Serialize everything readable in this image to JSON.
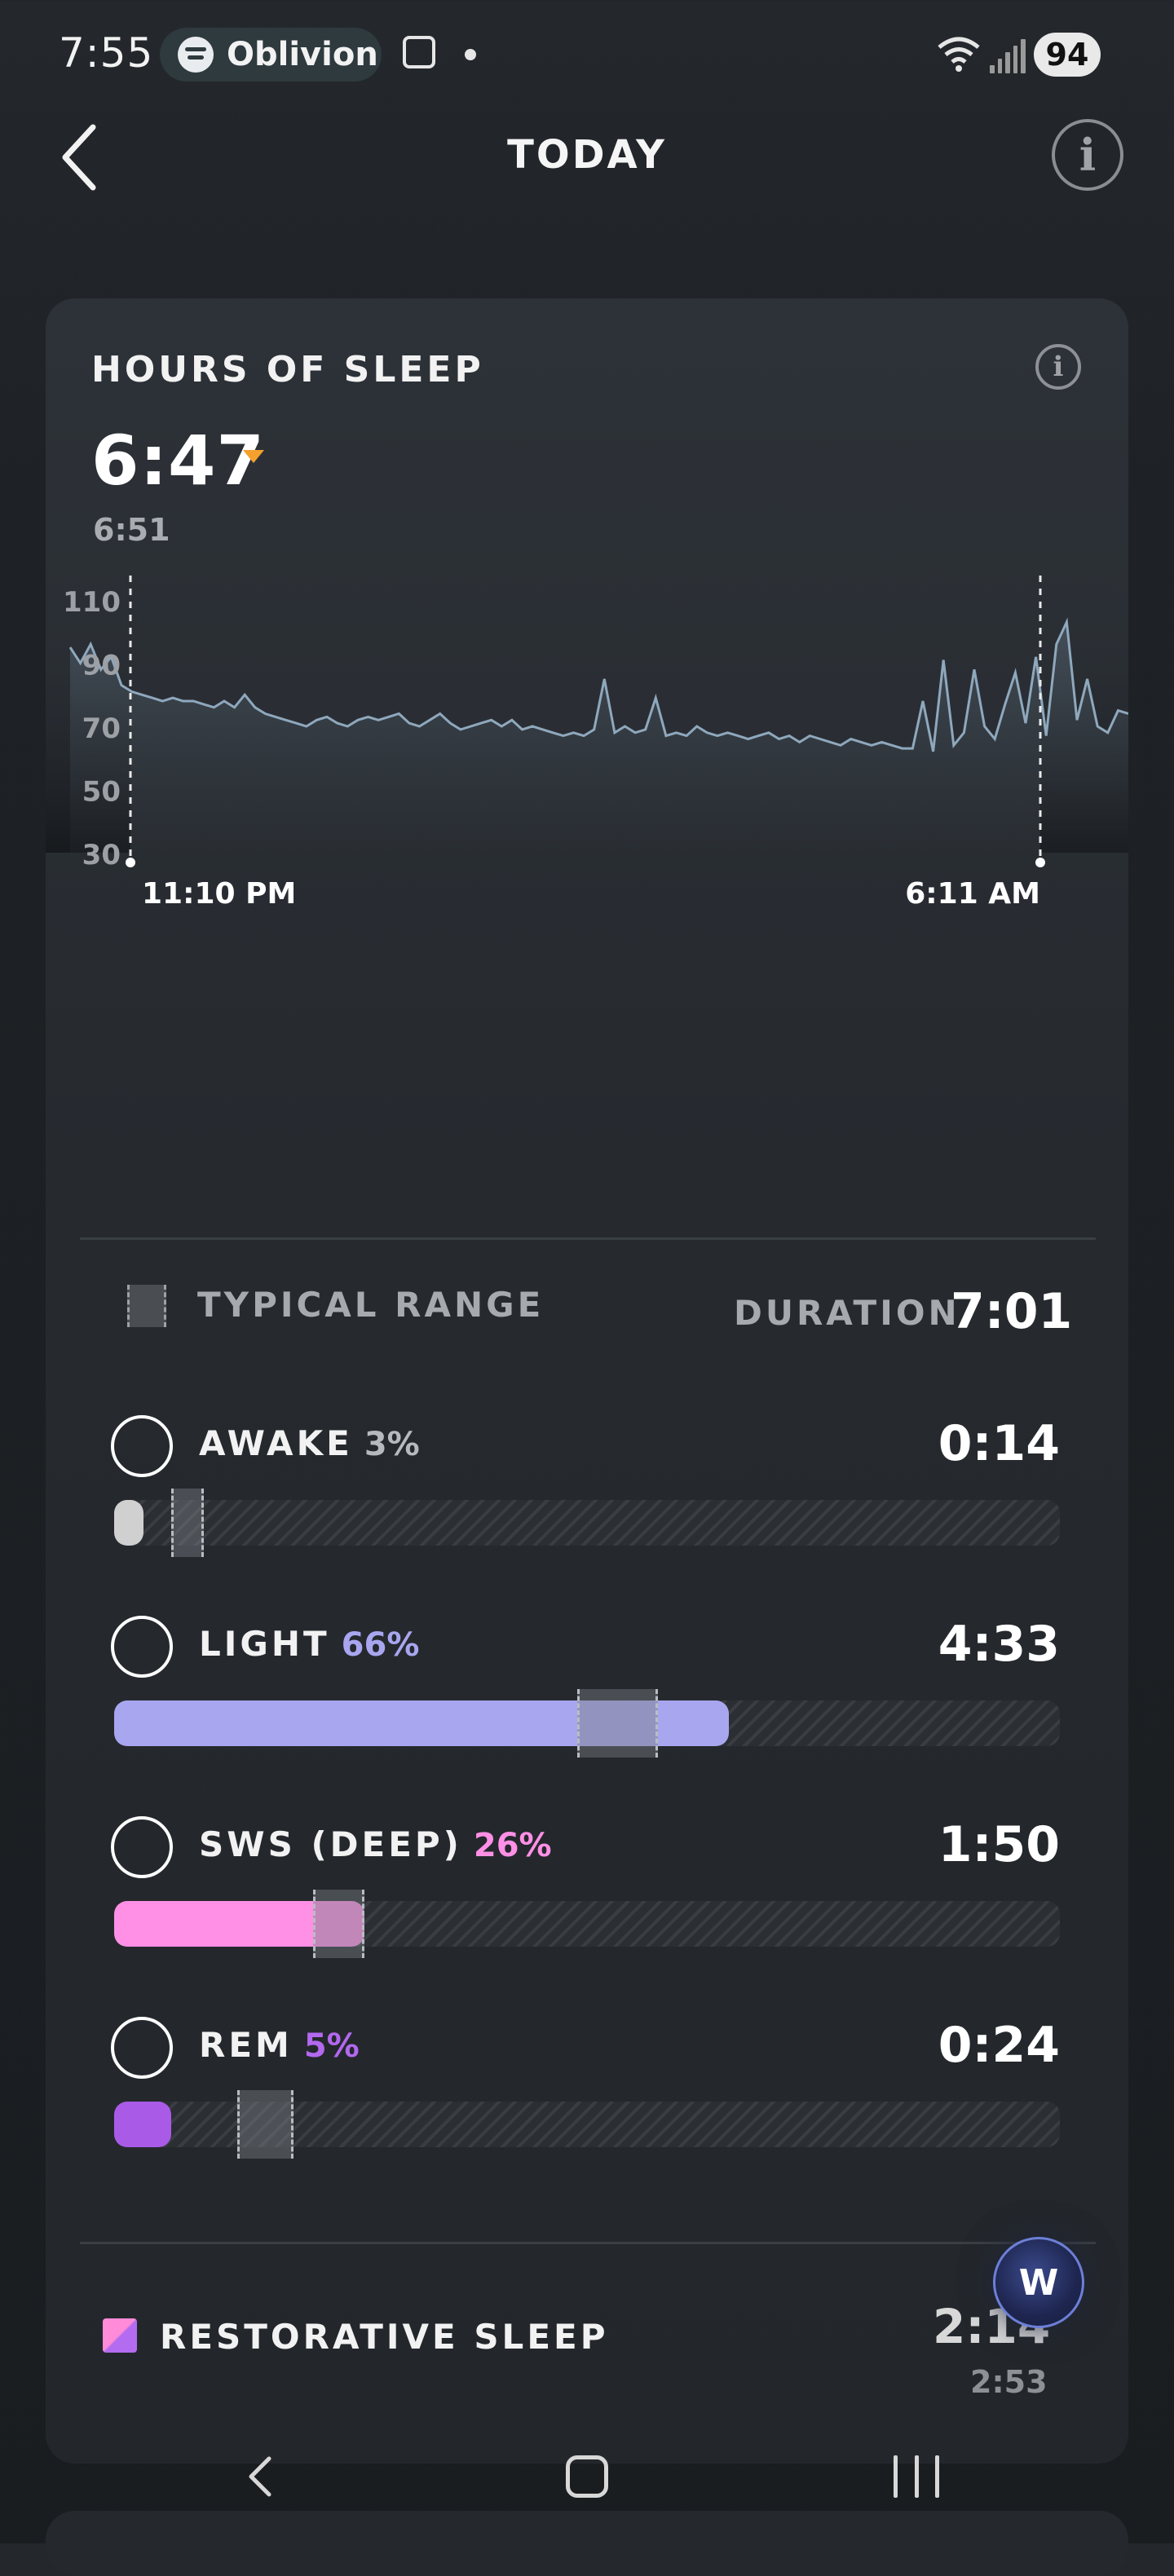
{
  "status_bar": {
    "time": "7:55",
    "media_app": "Oblivion",
    "battery": "94"
  },
  "header": {
    "title": "TODAY",
    "info_glyph": "i"
  },
  "sleep_card": {
    "title": "HOURS OF SLEEP",
    "info_glyph": "i",
    "hours": "6:47",
    "previous": "6:51",
    "accent_color": "#f4a12e",
    "chart": {
      "y_ticks": [
        "110",
        "90",
        "70",
        "50",
        "30"
      ],
      "start_label": "11:10 PM",
      "end_label": "6:11 AM"
    },
    "typical_range_label": "TYPICAL RANGE",
    "duration_label": "DURATION",
    "duration_value": "7:01",
    "stages": [
      {
        "name": "AWAKE",
        "pct": "3%",
        "time": "0:14",
        "color": "#d0d0d0",
        "pct_color": "#b7babd",
        "fill": 0.03,
        "range": [
          0.06,
          0.095
        ]
      },
      {
        "name": "LIGHT",
        "pct": "66%",
        "time": "4:33",
        "color": "#a9a6f0",
        "pct_color": "#a9a6f0",
        "fill": 0.65,
        "range": [
          0.49,
          0.575
        ]
      },
      {
        "name": "SWS (DEEP)",
        "pct": "26%",
        "time": "1:50",
        "color": "#ff90e6",
        "pct_color": "#ff90e6",
        "fill": 0.265,
        "range": [
          0.21,
          0.265
        ]
      },
      {
        "name": "REM",
        "pct": "5%",
        "time": "0:24",
        "color": "#a95be8",
        "pct_color": "#b368ef",
        "fill": 0.06,
        "range": [
          0.13,
          0.19
        ]
      }
    ],
    "restorative": {
      "label": "RESTORATIVE SLEEP",
      "value": "2:14",
      "previous": "2:53"
    }
  },
  "chart_data": {
    "type": "line",
    "yticks": [
      110,
      90,
      70,
      50,
      30
    ],
    "ylim": [
      30,
      110
    ],
    "x_start_label": "11:10 PM",
    "x_end_label": "6:11 AM",
    "series": [
      {
        "values": [
          95,
          90,
          96,
          88,
          92,
          83,
          81,
          80,
          79,
          78,
          79,
          78,
          78,
          77,
          76,
          78,
          76,
          80,
          76,
          74,
          73,
          72,
          71,
          70,
          72,
          73,
          71,
          70,
          72,
          73,
          72,
          73,
          74,
          71,
          70,
          72,
          74,
          71,
          69,
          70,
          71,
          72,
          70,
          72,
          69,
          70,
          69,
          68,
          67,
          68,
          67,
          69,
          85,
          68,
          70,
          68,
          69,
          79,
          67,
          68,
          67,
          70,
          68,
          67,
          68,
          67,
          66,
          67,
          68,
          66,
          67,
          65,
          67,
          66,
          65,
          64,
          66,
          65,
          64,
          65,
          64,
          63,
          63,
          78,
          62,
          91,
          64,
          68,
          88,
          70,
          66,
          77,
          87,
          71,
          92,
          67,
          96,
          103,
          72,
          85,
          70,
          68,
          75,
          74
        ]
      }
    ]
  }
}
